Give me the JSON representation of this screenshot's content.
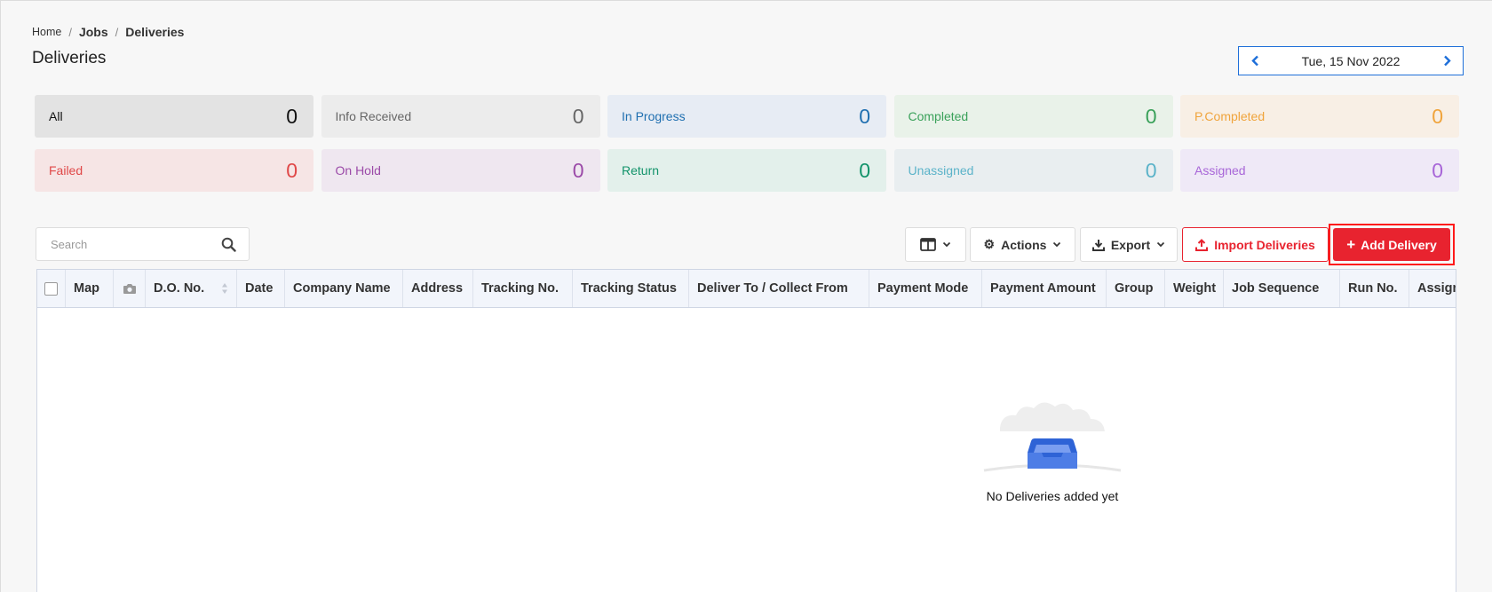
{
  "breadcrumb": {
    "home": "Home",
    "jobs": "Jobs",
    "current": "Deliveries"
  },
  "page_title": "Deliveries",
  "date_nav": {
    "date": "Tue, 15 Nov 2022"
  },
  "stats": [
    {
      "label": "All",
      "count": "0",
      "bg": "#e3e3e3",
      "color": "#111111"
    },
    {
      "label": "Info Received",
      "count": "0",
      "bg": "#ececec",
      "color": "#666666"
    },
    {
      "label": "In Progress",
      "count": "0",
      "bg": "#e7ecf4",
      "color": "#1f6fb0"
    },
    {
      "label": "Completed",
      "count": "0",
      "bg": "#e9f2e9",
      "color": "#3aa15a"
    },
    {
      "label": "P.Completed",
      "count": "0",
      "bg": "#f8efe5",
      "color": "#f0a43c"
    },
    {
      "label": "Failed",
      "count": "0",
      "bg": "#f6e5e5",
      "color": "#e04848"
    },
    {
      "label": "On Hold",
      "count": "0",
      "bg": "#efe7f0",
      "color": "#9b4aa8"
    },
    {
      "label": "Return",
      "count": "0",
      "bg": "#e3f0eb",
      "color": "#12936a"
    },
    {
      "label": "Unassigned",
      "count": "0",
      "bg": "#e9eef0",
      "color": "#5bb3c9"
    },
    {
      "label": "Assigned",
      "count": "0",
      "bg": "#efe9f7",
      "color": "#a866d8"
    }
  ],
  "search": {
    "placeholder": "Search"
  },
  "toolbar": {
    "actions": "Actions",
    "export": "Export",
    "import": "Import Deliveries",
    "add": "Add Delivery"
  },
  "table": {
    "headers": [
      "Map",
      "D.O. No.",
      "Date",
      "Company Name",
      "Address",
      "Tracking No.",
      "Tracking Status",
      "Deliver To / Collect From",
      "Payment Mode",
      "Payment Amount",
      "Group",
      "Weight",
      "Job Sequence",
      "Run No.",
      "Assigned To"
    ],
    "empty_message": "No Deliveries added yet"
  }
}
